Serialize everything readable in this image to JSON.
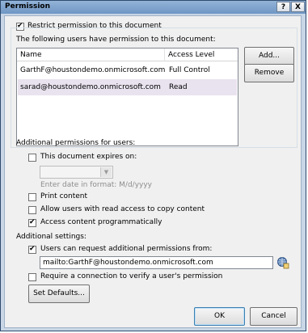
{
  "window": {
    "title": "Permission",
    "help_button": "?",
    "close_button": "X"
  },
  "restrict": {
    "label": "Restrict permission to this document",
    "checked": true
  },
  "users_section": {
    "label": "The following users have permission to this document:",
    "columns": [
      "Name",
      "Access Level"
    ],
    "rows": [
      {
        "name": "GarthF@houstondemo.onmicrosoft.com",
        "access": "Full Control",
        "selected": false
      },
      {
        "name": "sarad@houstondemo.onmicrosoft.com",
        "access": "Read",
        "selected": true
      }
    ],
    "add_button": "Add...",
    "remove_button": "Remove"
  },
  "additional_permissions": {
    "label": "Additional permissions for users:",
    "expires_label": "This document expires on:",
    "expires_checked": false,
    "date_value": "",
    "date_hint": "Enter date in format: M/d/yyyy",
    "print_label": "Print content",
    "print_checked": false,
    "copy_label": "Allow users with read access to copy content",
    "copy_checked": false,
    "programmatic_label": "Access content programmatically",
    "programmatic_checked": true
  },
  "additional_settings": {
    "label": "Additional settings:",
    "request_label": "Users can request additional permissions from:",
    "request_checked": true,
    "request_value": "mailto:GarthF@houstondemo.onmicrosoft.com",
    "verify_label": "Require a connection to verify a user's permission",
    "verify_checked": false,
    "set_defaults_button": "Set Defaults..."
  },
  "footer": {
    "ok_button": "OK",
    "cancel_button": "Cancel"
  }
}
